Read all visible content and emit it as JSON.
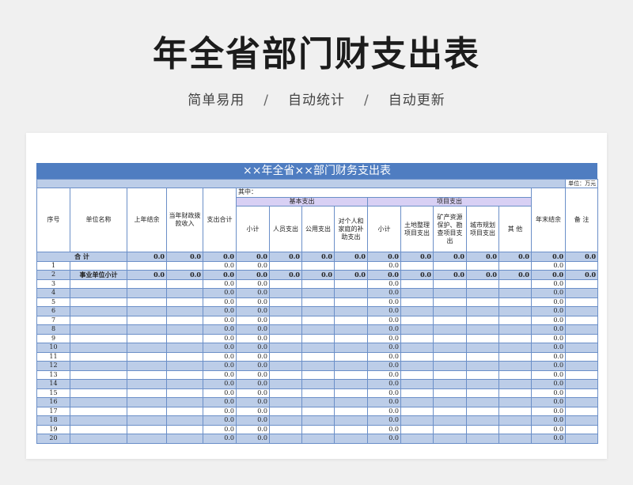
{
  "page": {
    "title": "年全省部门财支出表",
    "subtitle": [
      "简单易用",
      "自动统计",
      "自动更新"
    ],
    "separator": "/"
  },
  "sheet": {
    "title": "××年全省××部门财务支出表",
    "unit": "单位：万元",
    "headers": {
      "seq": "序号",
      "name": "单位名称",
      "last_year": "上年结余",
      "current_income": "当年财政拨款收入",
      "total_spend": "支出合计",
      "of_which": "其中：",
      "basic": "基本支出",
      "project": "项目支出",
      "subtotal1": "小计",
      "personnel": "人员支出",
      "public": "公用支出",
      "household": "对个人和家庭的补助支出",
      "subtotal2": "小计",
      "land": "土地整理项目支出",
      "mineral": "矿产资源保护、勘查项目支出",
      "urban": "城市规划项目支出",
      "other": "其 他",
      "year_end": "年末结余",
      "note": "备 注"
    },
    "total_row": {
      "label": "合 计",
      "values": [
        "0.0",
        "0.0",
        "0.0",
        "0.0",
        "0.0",
        "0.0",
        "0.0",
        "0.0",
        "0.0",
        "0.0",
        "0.0",
        "0.0",
        "0.0",
        "0.0"
      ]
    },
    "rows": [
      {
        "seq": "1",
        "name": "",
        "total": "0.0",
        "sub1": "0.0",
        "sub2": "0.0",
        "end": "0.0"
      },
      {
        "seq": "2",
        "name": "事业单位小计",
        "full": [
          "0.0",
          "0.0",
          "0.0",
          "0.0",
          "0.0",
          "0.0",
          "0.0",
          "0.0",
          "0.0",
          "0.0",
          "0.0",
          "0.0",
          "0.0",
          "0.0"
        ]
      },
      {
        "seq": "3",
        "total": "0.0",
        "sub1": "0.0",
        "sub2": "0.0",
        "end": "0.0"
      },
      {
        "seq": "4",
        "total": "0.0",
        "sub1": "0.0",
        "sub2": "0.0",
        "end": "0.0"
      },
      {
        "seq": "5",
        "total": "0.0",
        "sub1": "0.0",
        "sub2": "0.0",
        "end": "0.0"
      },
      {
        "seq": "6",
        "total": "0.0",
        "sub1": "0.0",
        "sub2": "0.0",
        "end": "0.0"
      },
      {
        "seq": "7",
        "total": "0.0",
        "sub1": "0.0",
        "sub2": "0.0",
        "end": "0.0"
      },
      {
        "seq": "8",
        "total": "0.0",
        "sub1": "0.0",
        "sub2": "0.0",
        "end": "0.0"
      },
      {
        "seq": "9",
        "total": "0.0",
        "sub1": "0.0",
        "sub2": "0.0",
        "end": "0.0"
      },
      {
        "seq": "10",
        "total": "0.0",
        "sub1": "0.0",
        "sub2": "0.0",
        "end": "0.0"
      },
      {
        "seq": "11",
        "total": "0.0",
        "sub1": "0.0",
        "sub2": "0.0",
        "end": "0.0"
      },
      {
        "seq": "12",
        "total": "0.0",
        "sub1": "0.0",
        "sub2": "0.0",
        "end": "0.0"
      },
      {
        "seq": "13",
        "total": "0.0",
        "sub1": "0.0",
        "sub2": "0.0",
        "end": "0.0"
      },
      {
        "seq": "14",
        "total": "0.0",
        "sub1": "0.0",
        "sub2": "0.0",
        "end": "0.0"
      },
      {
        "seq": "15",
        "total": "0.0",
        "sub1": "0.0",
        "sub2": "0.0",
        "end": "0.0"
      },
      {
        "seq": "16",
        "total": "0.0",
        "sub1": "0.0",
        "sub2": "0.0",
        "end": "0.0"
      },
      {
        "seq": "17",
        "total": "0.0",
        "sub1": "0.0",
        "sub2": "0.0",
        "end": "0.0"
      },
      {
        "seq": "18",
        "total": "0.0",
        "sub1": "0.0",
        "sub2": "0.0",
        "end": "0.0"
      },
      {
        "seq": "19",
        "total": "0.0",
        "sub1": "0.0",
        "sub2": "0.0",
        "end": "0.0"
      },
      {
        "seq": "20",
        "total": "0.0",
        "sub1": "0.0",
        "sub2": "0.0",
        "end": "0.0"
      }
    ]
  },
  "colors": {
    "banner": "#4f7dc1",
    "row_alt": "#bccde8",
    "header_band": "#d8d0f4",
    "border": "#6b8fc8"
  }
}
